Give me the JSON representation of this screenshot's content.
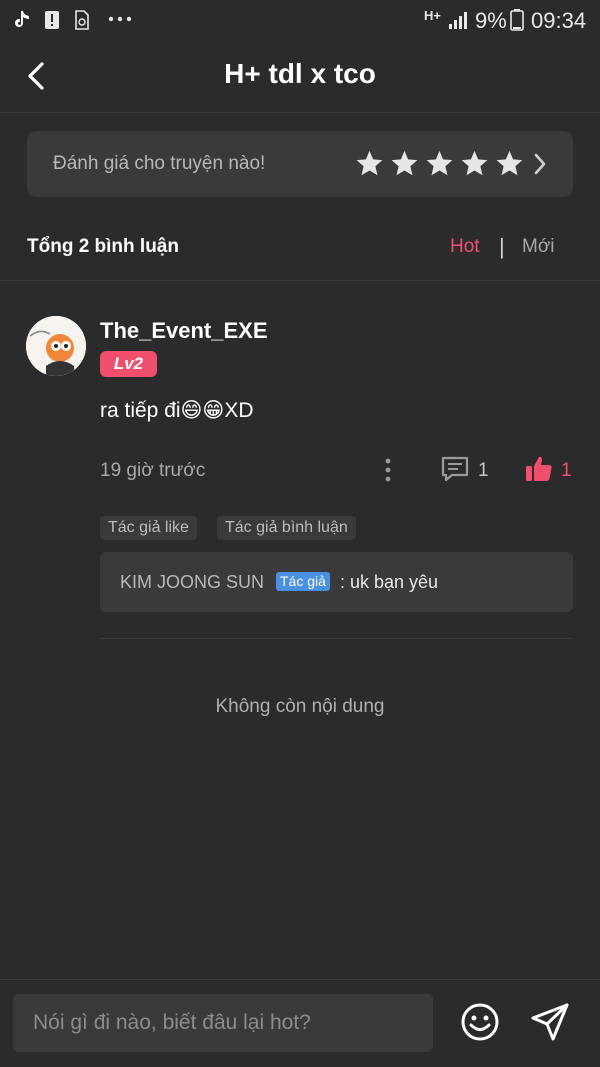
{
  "status_bar": {
    "network": "H+",
    "battery": "9%",
    "time": "09:34",
    "icons": [
      "tiktok-icon",
      "alert-icon",
      "sim-icon",
      "more-icon",
      "network-icon",
      "signal-icon",
      "battery-icon"
    ]
  },
  "header": {
    "title": "H+ tdl x tco",
    "back_icon": "chevron-left-icon"
  },
  "rating": {
    "prompt": "Đánh giá cho truyện nào!",
    "stars": 5,
    "star_color": "#e6e6e6"
  },
  "summary": {
    "total": "Tổng 2 bình luận",
    "sort_hot": "Hot",
    "separator": "|",
    "sort_new": "Mới",
    "active_color": "#f0506e"
  },
  "comment": {
    "username": "The_Event_EXE",
    "level": "Lv2",
    "text": "ra tiếp đi😄😁XD",
    "time": "19 giờ trước",
    "reply_count": "1",
    "like_count": "1",
    "tags": [
      "Tác giả like",
      "Tác giả bình luận"
    ],
    "reply": {
      "author": "KIM JOONG SUN",
      "badge": "Tác giả",
      "text": ": uk bạn yêu"
    }
  },
  "end_message": "Không còn nội dung",
  "input": {
    "placeholder": "Nói gì đi nào, biết đâu lại hot?"
  },
  "colors": {
    "background": "#2b2b2b",
    "card": "#3a3a3a",
    "accent": "#f0506e",
    "badge_blue": "#4a90e2"
  }
}
